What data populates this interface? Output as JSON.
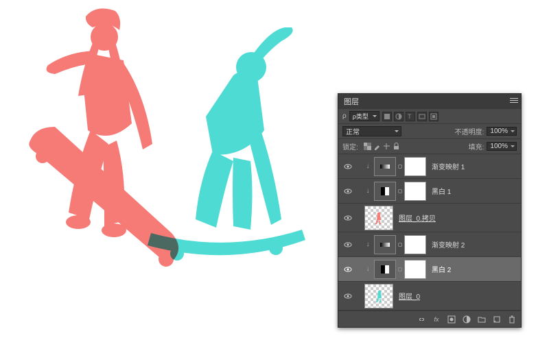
{
  "canvas": {
    "red_tone": "#f67a75",
    "cyan_tone": "#4edbd4"
  },
  "panel": {
    "title": "图层",
    "filter_label": "ρ类型",
    "blend_mode": "正常",
    "opacity_label": "不透明度:",
    "opacity_value": "100%",
    "lock_label": "锁定:",
    "fill_label": "填充:",
    "fill_value": "100%",
    "layers": [
      {
        "name": "渐变映射 1",
        "kind": "adj-grad",
        "clipped": true
      },
      {
        "name": "黑白 1",
        "kind": "adj-bw",
        "clipped": true
      },
      {
        "name": "图层_0.拷贝",
        "kind": "img",
        "clipped": false
      },
      {
        "name": "渐变映射 2",
        "kind": "adj-grad",
        "clipped": true
      },
      {
        "name": "黑白 2",
        "kind": "adj-bw",
        "clipped": true,
        "selected": true
      },
      {
        "name": "图层_0",
        "kind": "img",
        "clipped": false
      }
    ],
    "footer_icons": [
      "link",
      "fx",
      "mask",
      "adjust",
      "group",
      "new",
      "trash"
    ]
  }
}
